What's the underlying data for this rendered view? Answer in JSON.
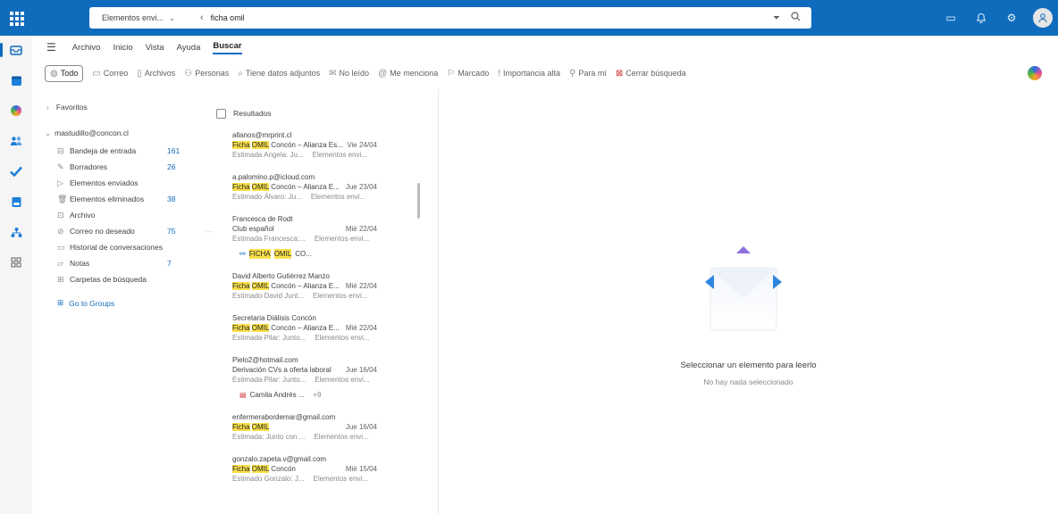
{
  "search": {
    "scope": "Elementos envi...",
    "query": "ficha omil"
  },
  "ribbon": {
    "tabs": [
      "Archivo",
      "Inicio",
      "Vista",
      "Ayuda",
      "Buscar"
    ]
  },
  "filters": [
    {
      "label": "Todo",
      "icon": "globe-icon"
    },
    {
      "label": "Correo",
      "icon": "mail-icon"
    },
    {
      "label": "Archivos",
      "icon": "file-icon"
    },
    {
      "label": "Personas",
      "icon": "people-icon"
    },
    {
      "label": "Tiene datos adjuntos",
      "icon": "paperclip-icon"
    },
    {
      "label": "No leído",
      "icon": "unread-icon"
    },
    {
      "label": "Me menciona",
      "icon": "at-icon"
    },
    {
      "label": "Marcado",
      "icon": "flag-icon"
    },
    {
      "label": "Importancia alta",
      "icon": "important-icon"
    },
    {
      "label": "Para mí",
      "icon": "person-icon"
    },
    {
      "label": "Cerrar búsqueda",
      "icon": "close-search-icon"
    }
  ],
  "folders": {
    "favorites": "Favoritos",
    "account": "mastudillo@concon.cl",
    "items": [
      {
        "label": "Bandeja de entrada",
        "count": "161",
        "icon": "inbox-icon"
      },
      {
        "label": "Borradores",
        "count": "26",
        "icon": "draft-icon"
      },
      {
        "label": "Elementos enviados",
        "count": "",
        "icon": "send-icon"
      },
      {
        "label": "Elementos eliminados",
        "count": "38",
        "icon": "trash-icon"
      },
      {
        "label": "Archivo",
        "count": "",
        "icon": "archive-icon"
      },
      {
        "label": "Correo no deseado",
        "count": "75",
        "icon": "junk-icon"
      },
      {
        "label": "Historial de conversaciones",
        "count": "",
        "icon": "folder-icon"
      },
      {
        "label": "Notas",
        "count": "7",
        "icon": "note-icon"
      },
      {
        "label": "Carpetas de búsqueda",
        "count": "",
        "icon": "search-folder-icon"
      }
    ],
    "groups_link": "Go to Groups"
  },
  "list": {
    "header": "Resultados",
    "messages": [
      {
        "sender": "allanos@mrprint.cl",
        "subject_rest": "Concón – Alianza Es...",
        "date": "Vie 24/04",
        "preview": "Estimada Angela: Ju...",
        "folder": "Elementos envi...",
        "highlight": true
      },
      {
        "sender": "a.palomino.p@icloud.com",
        "subject_rest": "Concón – Alianza E...",
        "date": "Jue 23/04",
        "preview": "Estimado Álvaro: Ju...",
        "folder": "Elementos envi...",
        "highlight": true
      },
      {
        "sender": "Francesca de Rodt",
        "subject_plain": "Club español",
        "date": "Mié 22/04",
        "preview": "Estimada Francesca:...",
        "folder": "Elementos envi...",
        "attachment": "CO...",
        "highlight": false
      },
      {
        "sender": "David Alberto Gutiérrez Manzo",
        "subject_rest": "Concón – Alianza E...",
        "date": "Mié 22/04",
        "preview": "Estimado David Junt...",
        "folder": "Elementos envi...",
        "highlight": true
      },
      {
        "sender": "Secretaria Diálisis Concón",
        "subject_rest": "Concón – Alianza E...",
        "date": "Mié 22/04",
        "preview": "Estimada Pilar: Junto...",
        "folder": "Elementos envi...",
        "highlight": true
      },
      {
        "sender": "Pielo2@hotmail.com",
        "subject_plain": "Derivación CVs a oferta laboral",
        "date": "Jue 16/04",
        "preview": "Estimada Pilar: Junto...",
        "folder": "Elementos envi...",
        "attachment": "Camila Andrés ...",
        "extra": "+9",
        "highlight": false
      },
      {
        "sender": "enfermerabordemar@gmail.com",
        "subject_rest": "",
        "date": "Jue 16/04",
        "preview": "Estimada: Junto con ...",
        "folder": "Elementos envi...",
        "highlight": true
      },
      {
        "sender": "gonzalo.zapeta.v@gmail.com",
        "subject_rest": "Concón",
        "date": "Mié 15/04",
        "preview": "Estimado Gonzalo: J...",
        "folder": "Elementos envi...",
        "highlight": true
      }
    ],
    "hl_ficha": "Ficha",
    "hl_omil": "OMIL",
    "attach_ficha": "FICHA",
    "attach_omil": "OMIL"
  },
  "reading": {
    "title": "Seleccionar un elemento para leerlo",
    "subtitle": "No hay nada seleccionado"
  },
  "colors": {
    "brand": "#0f6cbd",
    "highlight": "#f9e04b"
  }
}
